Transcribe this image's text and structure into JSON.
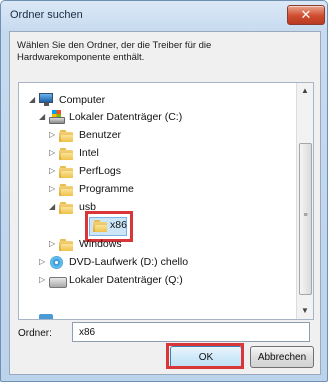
{
  "dialog": {
    "title": "Ordner suchen",
    "close_label": "✕",
    "description": "Wählen Sie den Ordner, der die Treiber für die Hardwarekomponente enthält."
  },
  "tree": {
    "items": [
      {
        "label": "Computer",
        "expander": "◢",
        "icon": "computer-icon"
      },
      {
        "label": "Lokaler Datenträger (C:)",
        "expander": "◢",
        "icon": "drive-c-icon"
      },
      {
        "label": "Benutzer",
        "expander": "▷",
        "icon": "folder-icon"
      },
      {
        "label": "Intel",
        "expander": "▷",
        "icon": "folder-icon"
      },
      {
        "label": "PerfLogs",
        "expander": "▷",
        "icon": "folder-icon"
      },
      {
        "label": "Programme",
        "expander": "▷",
        "icon": "folder-icon"
      },
      {
        "label": "usb",
        "expander": "◢",
        "icon": "folder-icon"
      },
      {
        "label": "x86",
        "expander": "",
        "icon": "folder-icon",
        "selected": true
      },
      {
        "label": "Windows",
        "expander": "▷",
        "icon": "folder-icon"
      },
      {
        "label": "DVD-Laufwerk (D:) chello",
        "expander": "▷",
        "icon": "dvd-icon"
      },
      {
        "label": "Lokaler Datenträger (Q:)",
        "expander": "▷",
        "icon": "drive-icon"
      }
    ],
    "scroll_up": "▲",
    "scroll_down": "▼",
    "scroll_grip": "≡"
  },
  "folder_field": {
    "label": "Ordner:",
    "value": "x86"
  },
  "buttons": {
    "ok": "OK",
    "cancel": "Abbrechen"
  },
  "colors": {
    "highlight_box": "#d9363a",
    "selection": "#cde6f7"
  }
}
